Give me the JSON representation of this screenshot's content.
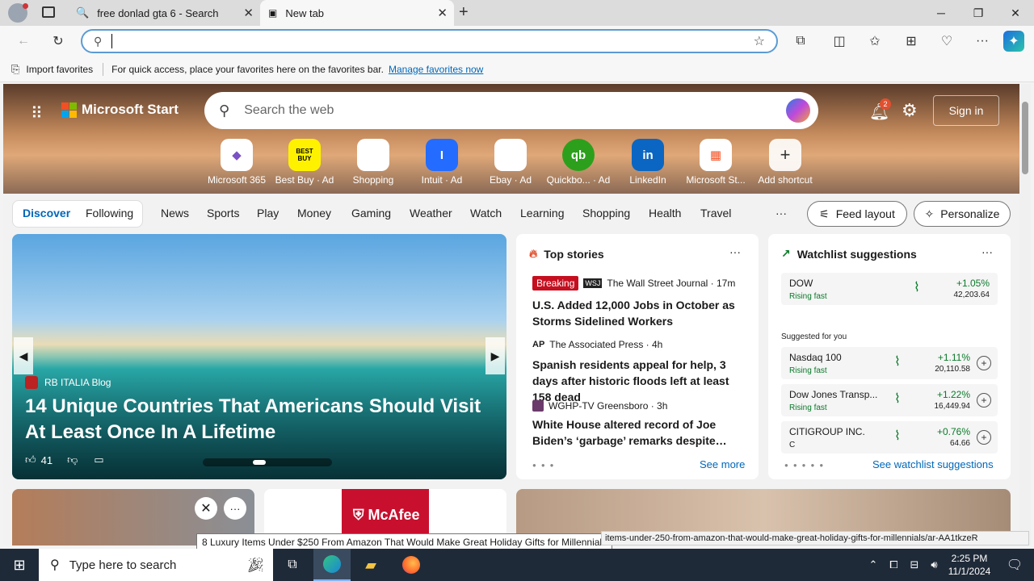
{
  "browser": {
    "tabs": [
      {
        "label": "free donlad gta 6 - Search"
      },
      {
        "label": "New tab"
      }
    ],
    "address_value": "",
    "favorites_bar": {
      "import_label": "Import favorites",
      "message": "For quick access, place your favorites here on the favorites bar.",
      "link": "Manage favorites now"
    }
  },
  "newtab": {
    "brand": "Microsoft Start",
    "search_placeholder": "Search the web",
    "notification_count": "2",
    "signin": "Sign in",
    "shortcuts": [
      {
        "label": "Microsoft 365",
        "glyph": "◆"
      },
      {
        "label": "Best Buy · Ad",
        "glyph": "BEST BUY"
      },
      {
        "label": "Shopping",
        "glyph": "🏷"
      },
      {
        "label": "Intuit · Ad",
        "glyph": "I"
      },
      {
        "label": "Ebay · Ad",
        "glyph": "🛍"
      },
      {
        "label": "Quickbo... · Ad",
        "glyph": "qb"
      },
      {
        "label": "LinkedIn",
        "glyph": "in"
      },
      {
        "label": "Microsoft St...",
        "glyph": "▦"
      },
      {
        "label": "Add shortcut",
        "glyph": "+"
      }
    ],
    "nav": {
      "discover": "Discover",
      "following": "Following",
      "items": [
        "News",
        "Sports",
        "Play",
        "Money",
        "Gaming",
        "Weather",
        "Watch",
        "Learning",
        "Shopping",
        "Health",
        "Travel"
      ],
      "more": "···",
      "feed_layout": "Feed layout",
      "personalize": "Personalize"
    },
    "hero_story": {
      "source": "RB ITALIA Blog",
      "title": "14 Unique Countries That Americans Should Visit At Least Once In A Lifetime",
      "likes": "41"
    },
    "top_stories": {
      "heading": "Top stories",
      "items": [
        {
          "badge": "Breaking",
          "source": "The Wall Street Journal · 17m",
          "headline": "U.S. Added 12,000 Jobs in October as Storms Sidelined Workers"
        },
        {
          "badge": "",
          "source": "The Associated Press · 4h",
          "headline": "Spanish residents appeal for help, 3 days after historic floods left at least 158 dead"
        },
        {
          "badge": "",
          "source": "WGHP-TV Greensboro · 3h",
          "headline": "White House altered record of Joe Biden’s ‘garbage’ remarks despite…"
        }
      ],
      "see_more": "See more"
    },
    "watchlist": {
      "heading": "Watchlist suggestions",
      "top": {
        "name": "DOW",
        "status": "Rising fast",
        "change": "+1.05%",
        "value": "42,203.64"
      },
      "suggested_label": "Suggested for you",
      "items": [
        {
          "name": "Nasdaq 100",
          "status": "Rising fast",
          "change": "+1.11%",
          "value": "20,110.58"
        },
        {
          "name": "Dow Jones Transp...",
          "status": "Rising fast",
          "change": "+1.22%",
          "value": "16,449.94"
        },
        {
          "name": "CITIGROUP INC.",
          "status": "C",
          "change": "+0.76%",
          "value": "64.66"
        }
      ],
      "link": "See watchlist suggestions"
    },
    "tooltip": "8 Luxury Items Under $250 From Amazon That Would Make Great Holiday Gifts for Millennials",
    "status_url": "items-under-250-from-amazon-that-would-make-great-holiday-gifts-for-millennials/ar-AA1tkzeR"
  },
  "taskbar": {
    "search_placeholder": "Type here to search",
    "time": "2:25 PM",
    "date": "11/1/2024"
  },
  "colors": {
    "accent": "#0067b8",
    "breaking": "#c50f1f",
    "gain": "#0a7a2a"
  }
}
